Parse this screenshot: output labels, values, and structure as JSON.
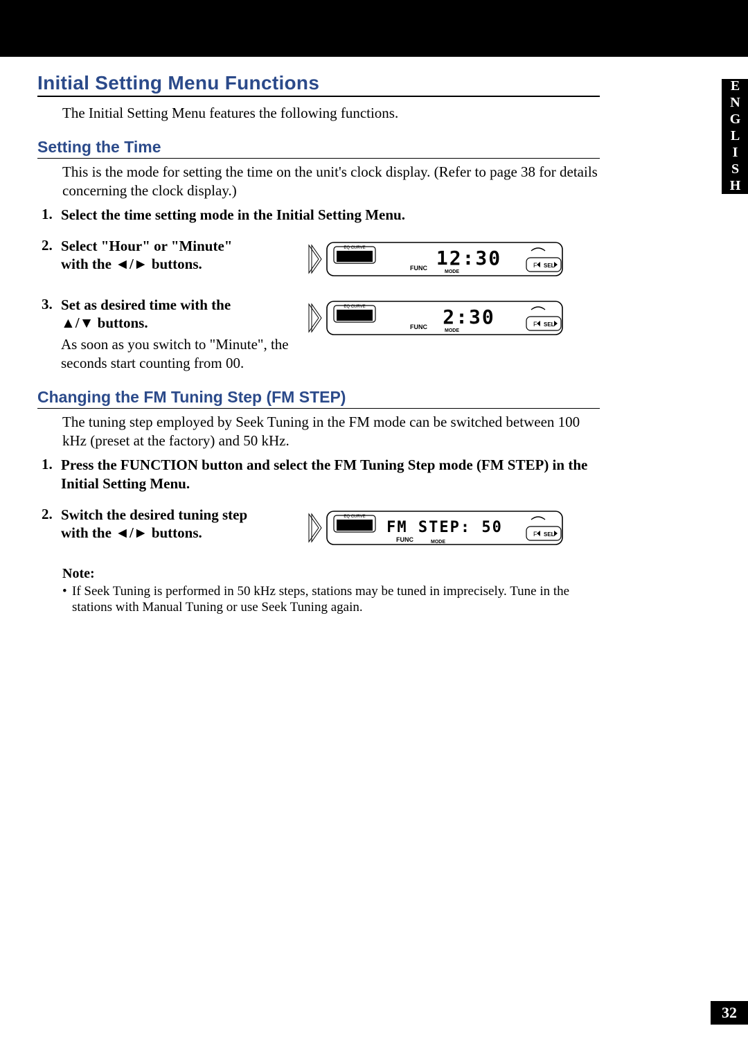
{
  "language_tab": "ENGLISH",
  "page_number": "32",
  "section1": {
    "title": "Initial Setting Menu Functions",
    "intro": "The Initial Setting Menu features the following functions."
  },
  "time": {
    "title": "Setting the Time",
    "intro": "This is the mode for setting the time on the unit's clock display. (Refer to page 38 for details concerning the clock display.)",
    "s1_num": "1.",
    "s1": "Select the time setting mode in the Initial Setting Menu.",
    "s2_num": "2.",
    "s2a": "Select \"Hour\" or \"Minute\"",
    "s2b": "with the ◄/► buttons.",
    "s3_num": "3.",
    "s3a": "Set as desired time with the",
    "s3b": "▲/▼ buttons.",
    "s3_sub": "As soon as you switch to \"Minute\", the seconds start counting from 00.",
    "fig1_text": "12:30",
    "fig2_text": "2:30"
  },
  "fmstep": {
    "title": "Changing the FM Tuning Step (FM STEP)",
    "intro": "The tuning step employed by Seek Tuning in the FM mode can be switched between 100 kHz (preset at the factory) and 50 kHz.",
    "s1_num": "1.",
    "s1": "Press the FUNCTION button and select the FM Tuning Step mode (FM STEP) in the Initial Setting Menu.",
    "s2_num": "2.",
    "s2a": "Switch the desired tuning step",
    "s2b": "with the ◄/► buttons.",
    "fig_text": "FM STEP: 50",
    "note_head": "Note:",
    "note1": "If Seek Tuning is performed in 50 kHz steps, stations may be tuned in imprecisely. Tune in the stations with Manual Tuning or use Seek Tuning again."
  },
  "lcd_labels": {
    "eq": "EQ CURVE",
    "func": "FUNC",
    "mode": "MODE",
    "sel": "SEL",
    "f": "F"
  }
}
